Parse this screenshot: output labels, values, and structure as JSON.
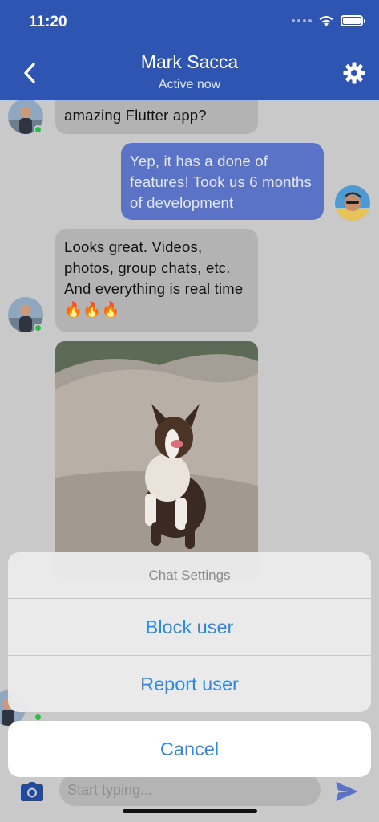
{
  "status_bar": {
    "time": "11:20"
  },
  "header": {
    "title": "Mark Sacca",
    "subtitle": "Active now",
    "back_icon": "chevron-left-icon",
    "settings_icon": "gear-icon"
  },
  "messages": [
    {
      "direction": "incoming",
      "text": "amazing Flutter app?"
    },
    {
      "direction": "outgoing",
      "text": "Yep, it has a done of features! Took us 6 months of development"
    },
    {
      "direction": "incoming",
      "text": "Looks great. Videos, photos, group chats, etc. And everything is real time 🔥🔥🔥"
    },
    {
      "direction": "incoming",
      "type": "image",
      "subject": "dog running on sand"
    }
  ],
  "action_sheet": {
    "title": "Chat Settings",
    "actions": [
      "Block user",
      "Report user"
    ],
    "cancel": "Cancel"
  },
  "composer": {
    "placeholder": "Start typing...",
    "camera_icon": "camera-icon",
    "send_icon": "send-icon"
  },
  "colors": {
    "header": "#2f55b3",
    "outgoing_bubble": "#5a73c6",
    "incoming_bubble": "#b3b3b3",
    "action_text": "#2e89e6",
    "online": "#2fb84a"
  }
}
